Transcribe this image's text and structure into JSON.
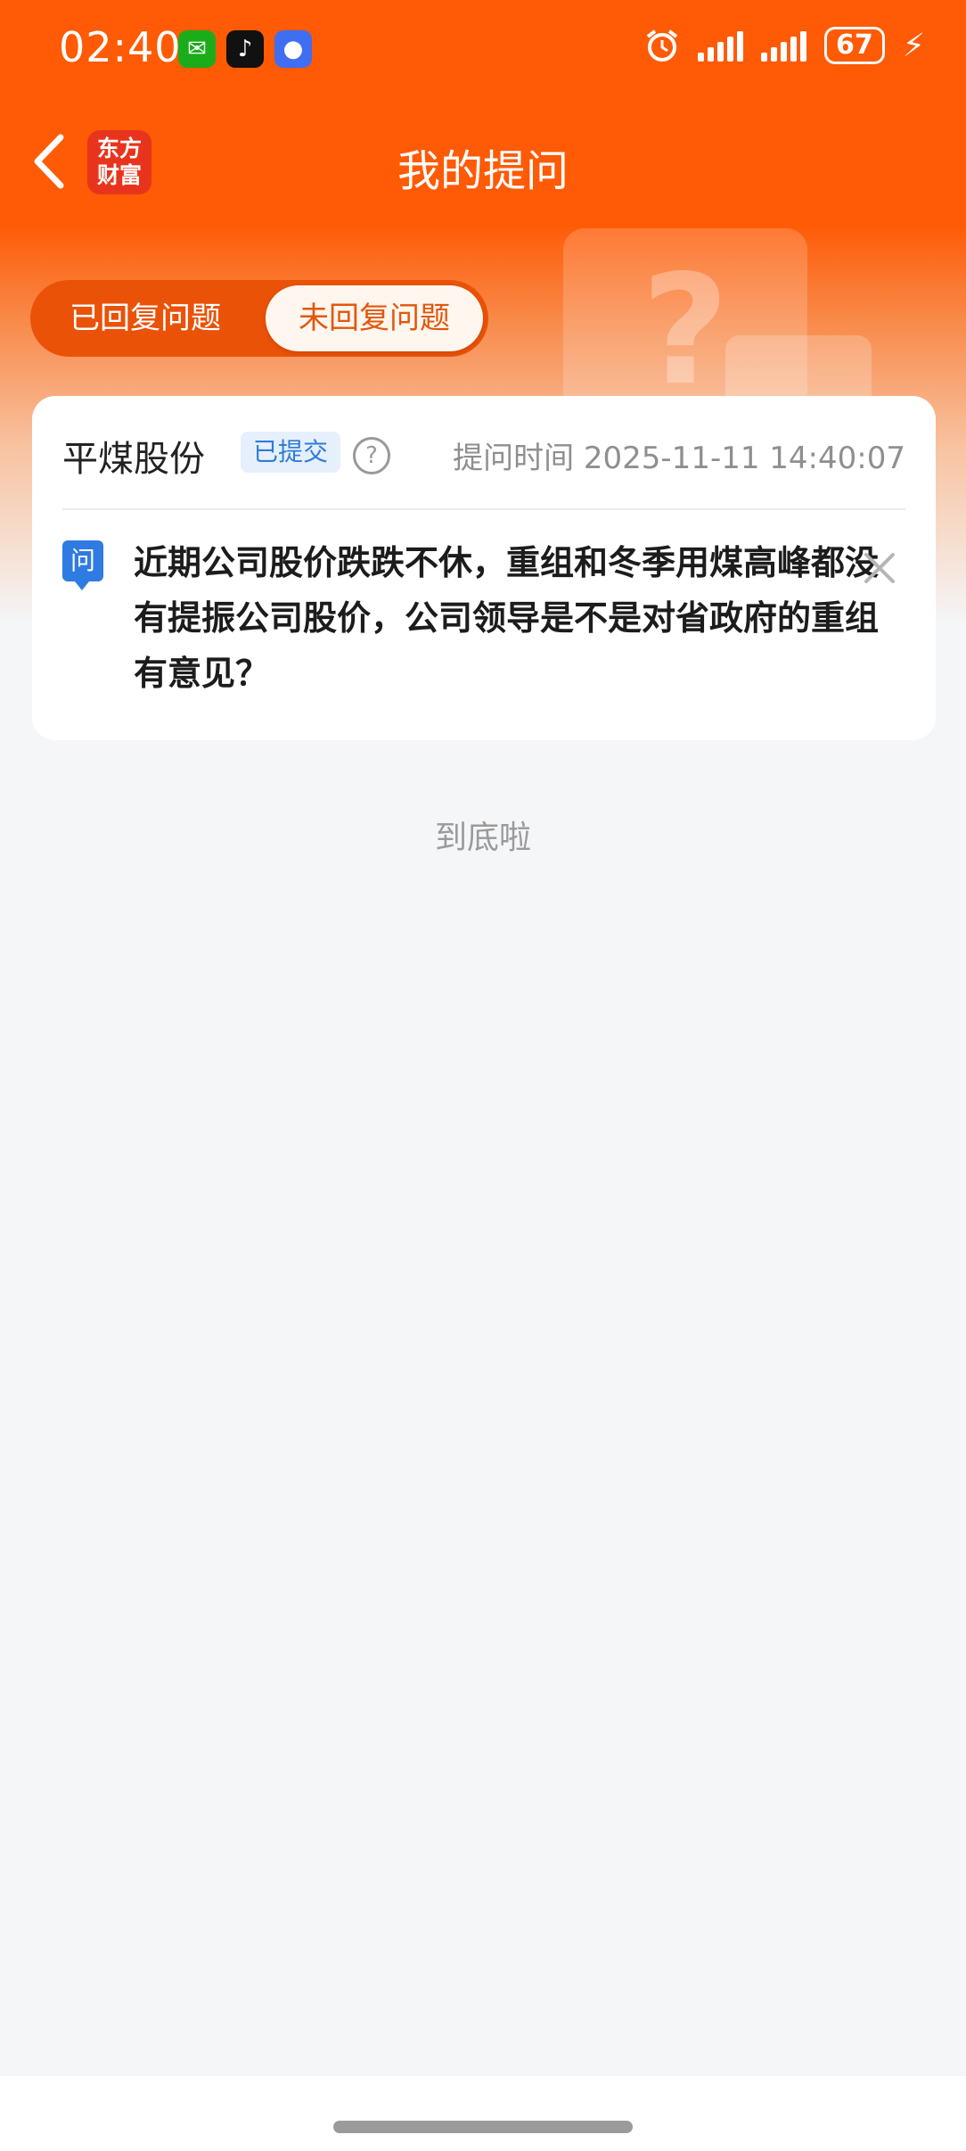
{
  "status_bar": {
    "time": "02:40",
    "battery": "67",
    "app_icons": [
      "wechat-icon",
      "tiktok-icon",
      "message-icon"
    ]
  },
  "nav": {
    "title": "我的提问",
    "logo_line1": "东方",
    "logo_line2": "财富"
  },
  "tabs": [
    {
      "label": "已回复问题",
      "selected": false
    },
    {
      "label": "未回复问题",
      "selected": true
    }
  ],
  "question_card": {
    "stock_name": "平煤股份",
    "status": "已提交",
    "help": "?",
    "ask_time": "提问时间 2025-11-11 14:40:07",
    "q_label": "问",
    "question": "近期公司股价跌跌不休，重组和冬季用煤高峰都没有提振公司股价，公司领导是不是对省政府的重组有意见？"
  },
  "list_end": "到底啦",
  "colors": {
    "brand_orange": "#ff5a05",
    "tab_selected_text": "#e2570b",
    "badge_blue": "#2f7cd8"
  }
}
